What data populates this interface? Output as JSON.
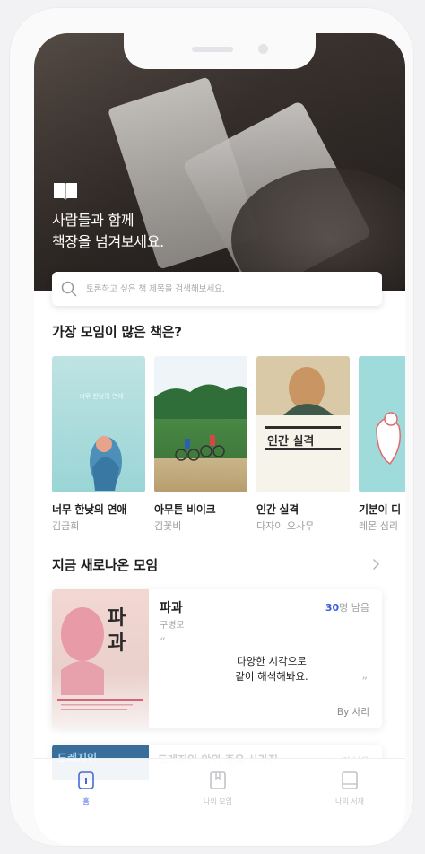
{
  "hero": {
    "line1": "사람들과 함께",
    "line2": "책장을 넘겨보세요."
  },
  "search": {
    "placeholder": "토론하고 싶은 책 제목을 검색해보세요."
  },
  "popular": {
    "title": "가장 모임이 많은 책은?",
    "books": [
      {
        "title": "너무 한낮의 연애",
        "author": "김금희",
        "cover_text": "너무 한낮의 연애"
      },
      {
        "title": "아무튼 비이크",
        "author": "김꽃비",
        "cover_text": ""
      },
      {
        "title": "인간 실격",
        "author": "다자이 오사무",
        "cover_text": "인간 실격"
      },
      {
        "title": "기분이 디",
        "author": "레몬 심리",
        "cover_text": ""
      }
    ]
  },
  "new_meetings": {
    "title": "지금 새로나온 모임",
    "card": {
      "cover_text": "파과",
      "name": "파과",
      "author": "구병모",
      "remaining_count": "30",
      "remaining_suffix": "명 남음",
      "quote_line1": "다양한 시각으로",
      "quote_line2": "같이 해석해봐요.",
      "by": "By 사리"
    },
    "card2": {
      "cover_text": "도레지인",
      "text": "도레지인 안의 충유 사라진",
      "right": "30명 남음"
    }
  },
  "tabs": [
    {
      "label": "홈"
    },
    {
      "label": "나의 모임"
    },
    {
      "label": "나의 서재"
    }
  ],
  "colors": {
    "accent": "#4a68d8",
    "remaining": "#3b5bdb"
  }
}
